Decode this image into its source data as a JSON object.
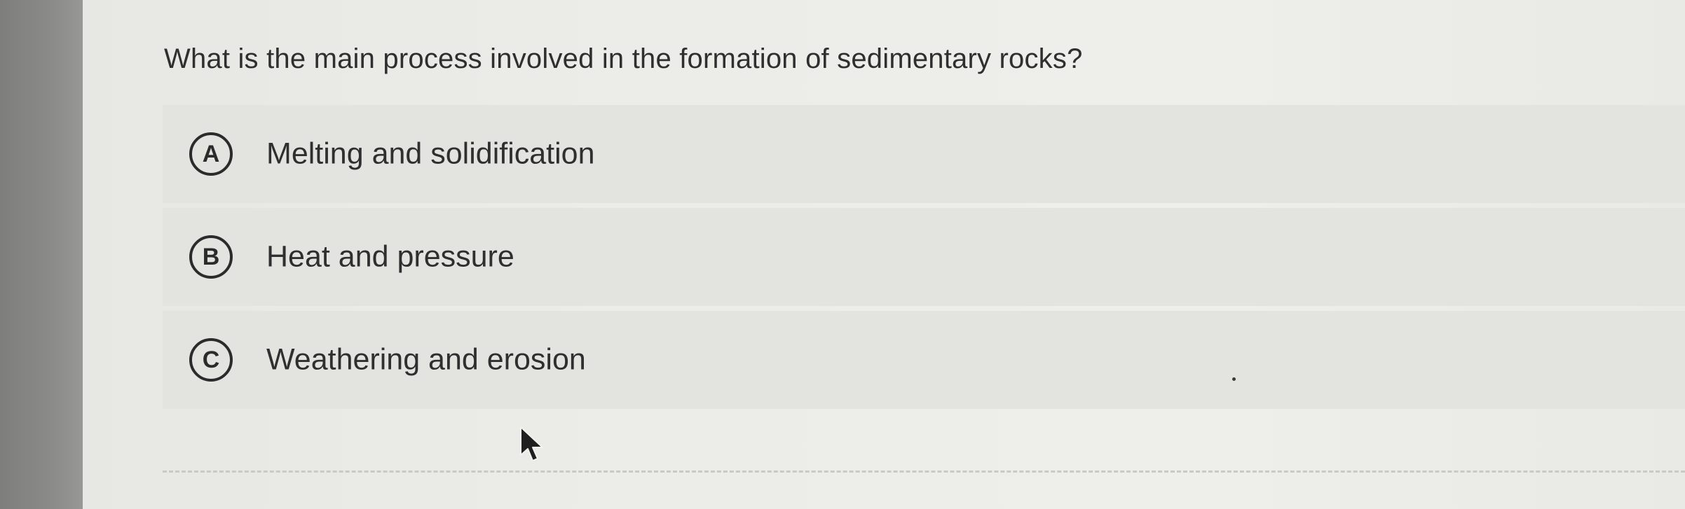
{
  "question": {
    "text": "What is the main process involved in the formation of sedimentary rocks?"
  },
  "options": [
    {
      "letter": "A",
      "label": "Melting and solidification"
    },
    {
      "letter": "B",
      "label": "Heat and pressure"
    },
    {
      "letter": "C",
      "label": "Weathering and erosion"
    }
  ],
  "icons": {
    "cursor": "mouse-pointer-icon"
  }
}
